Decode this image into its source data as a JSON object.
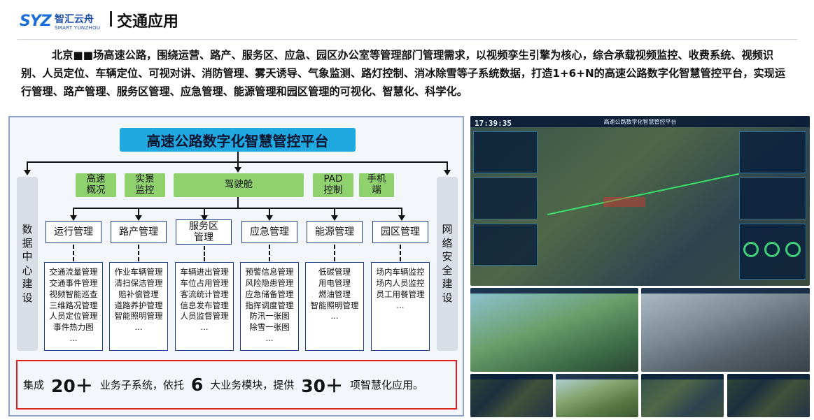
{
  "header": {
    "logo_mark": "SYZ",
    "logo_cn": "智汇云舟",
    "logo_en": "SMART YUNZHOU",
    "title": "交通应用"
  },
  "intro": "北京■■场高速公路，围绕运营、路产、服务区、应急、园区办公室等管理部门管理需求，以视频孪生引擎为核心，综合承载视频监控、收费系统、视频识别、人员定位、车辆定位、可视对讲、消防管理、雾天诱导、气象监测、路灯控制、消冰除雪等子系统数据，打造1+6+N的高速公路数字化智慧管控平台，实现运行管理、路产管理、服务区管理、应急管理、能源管理和园区管理的可视化、智慧化、科学化。",
  "diagram": {
    "platform_title": "高速公路数字化智慧管控平台",
    "left_column": [
      "数",
      "据",
      "中",
      "心",
      "建",
      "设"
    ],
    "right_column": [
      "网",
      "络",
      "安",
      "全",
      "建",
      "设"
    ],
    "entries": [
      {
        "line1": "高速",
        "line2": "概况"
      },
      {
        "line1": "实景",
        "line2": "监控"
      },
      {
        "line1": "驾驶舱",
        "line2": ""
      },
      {
        "line1": "PAD",
        "line2": "控制"
      },
      {
        "line1": "手机",
        "line2": "端"
      }
    ],
    "modules": [
      {
        "line1": "运行管理",
        "line2": "",
        "items": [
          "交通流量管理",
          "交通事件管理",
          "视频智能巡查",
          "三维路况管理",
          "人员定位管理",
          "事件热力图",
          "..."
        ]
      },
      {
        "line1": "路产管理",
        "line2": "",
        "items": [
          "作业车辆管理",
          "清扫保洁管理",
          "赔补偿管理",
          "道路养护管理",
          "智能照明管理",
          "..."
        ]
      },
      {
        "line1": "服务区",
        "line2": "管理",
        "items": [
          "车辆进出管理",
          "车位占用管理",
          "客流统计管理",
          "信息发布管理",
          "人员监督管理",
          "..."
        ]
      },
      {
        "line1": "应急管理",
        "line2": "",
        "items": [
          "预警信息管理",
          "风险隐患管理",
          "应急储备管理",
          "指挥调度管理",
          "防汛一张图",
          "除雪一张图",
          "..."
        ]
      },
      {
        "line1": "能源管理",
        "line2": "",
        "items": [
          "低碳管理",
          "用电管理",
          "燃油管理",
          "智能照明管理",
          "..."
        ]
      },
      {
        "line1": "园区管理",
        "line2": "",
        "items": [
          "场内车辆监控",
          "场内人员监控",
          "员工用餐管理",
          "..."
        ]
      }
    ]
  },
  "summary": {
    "t1": "集成",
    "n1": "20＋",
    "t2": "业务子系统，依托",
    "n2": "6",
    "t3": "大业务模块，提供",
    "n3": "30＋",
    "t4": "项智慧化应用。"
  },
  "screenshots": {
    "main_title": "高速公路数字化智慧管控平台",
    "main_time": "17:39:35"
  },
  "colors": {
    "platform_title_bg": "#20a8e0",
    "entry_green": "#8fd16d",
    "module_border": "#1f3f8f",
    "summary_border": "#e01f1f",
    "frame_border": "#8fa2c9",
    "logo_blue": "#1d6fd8"
  }
}
